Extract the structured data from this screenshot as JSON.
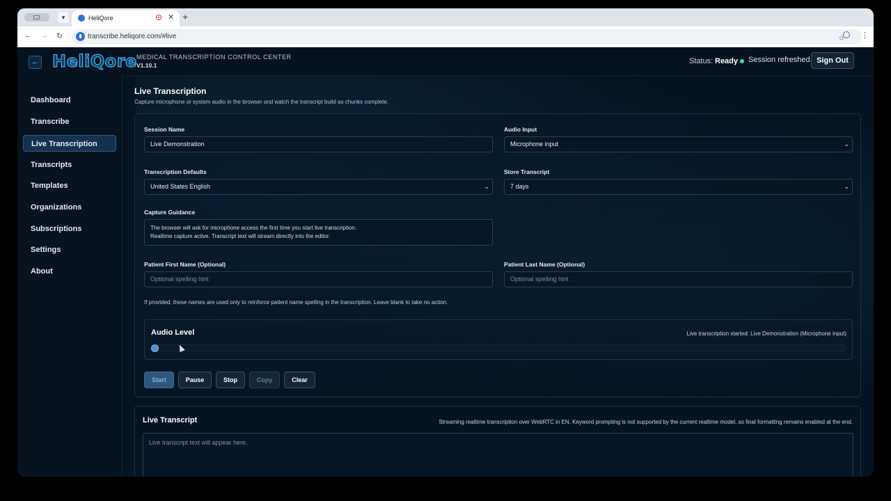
{
  "browser": {
    "tab_title": "HeliQore",
    "url": "transcribe.heliqore.com/#live"
  },
  "header": {
    "logo": "HeliQore",
    "title": "MEDICAL TRANSCRIPTION CONTROL CENTER",
    "version": "V1.10.1",
    "status_label": "Status:",
    "status_value": "Ready",
    "session_message": "Session refreshed.",
    "sign_out": "Sign Out"
  },
  "sidebar": {
    "items": [
      {
        "label": "Dashboard"
      },
      {
        "label": "Transcribe"
      },
      {
        "label": "Live Transcription"
      },
      {
        "label": "Transcripts"
      },
      {
        "label": "Templates"
      },
      {
        "label": "Organizations"
      },
      {
        "label": "Subscriptions"
      },
      {
        "label": "Settings"
      },
      {
        "label": "About"
      }
    ],
    "active_index": 2
  },
  "page": {
    "title": "Live Transcription",
    "subtitle": "Capture microphone or system audio in the browser and watch the transcript build as chunks complete."
  },
  "form": {
    "session_name_label": "Session Name",
    "session_name_value": "Live Demonstration",
    "audio_input_label": "Audio Input",
    "audio_input_value": "Microphone input",
    "defaults_label": "Transcription Defaults",
    "defaults_value": "United States English",
    "store_label": "Store Transcript",
    "store_value": "7 days",
    "guidance_label": "Capture Guidance",
    "guidance_line1": "The browser will ask for microphone access the first time you start live transcription.",
    "guidance_line2": "Realtime capture active. Transcript text will stream directly into the editor.",
    "first_name_label": "Patient First Name (Optional)",
    "first_name_placeholder": "Optional spelling hint",
    "last_name_label": "Patient Last Name (Optional)",
    "last_name_placeholder": "Optional spelling hint",
    "hint": "If provided, these names are used only to reinforce patient name spelling in the transcription. Leave blank to take no action."
  },
  "audio": {
    "title": "Audio Level",
    "status": "Live transcription started: Live Demonstration (Microphone input)",
    "level_fraction": 0.01
  },
  "controls": {
    "start": "Start",
    "pause": "Pause",
    "stop": "Stop",
    "copy": "Copy",
    "clear": "Clear"
  },
  "transcript": {
    "title": "Live Transcript",
    "info": "Streaming realtime transcription over WebRTC in EN. Keyword prompting is not supported by the current realtime model, so final formatting remains enabled at the end.",
    "placeholder": "Live transcript text will appear here."
  }
}
